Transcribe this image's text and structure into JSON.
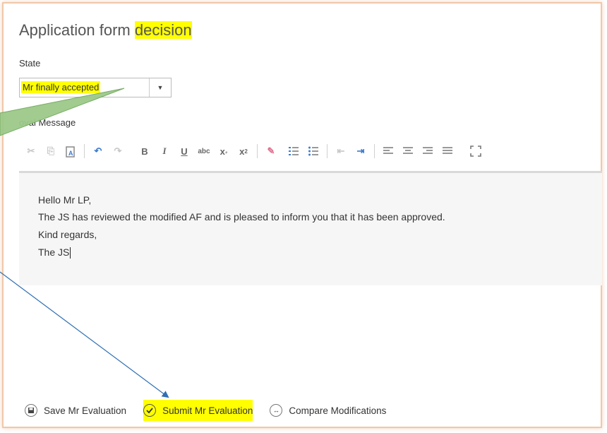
{
  "title": {
    "prefix": "Application form ",
    "highlight": "decision"
  },
  "state": {
    "label": "State",
    "selected": "Mr finally accepted"
  },
  "message": {
    "label": "oval Message"
  },
  "toolbar": {
    "items": [
      {
        "name": "cut-icon",
        "glyph": "✂"
      },
      {
        "name": "copy-icon",
        "glyph": "⎘"
      },
      {
        "name": "paste-text-icon",
        "glyph": "A"
      },
      {
        "name": "undo-icon",
        "glyph": "↶"
      },
      {
        "name": "redo-icon",
        "glyph": "↷"
      },
      {
        "name": "bold-icon",
        "glyph": "B"
      },
      {
        "name": "italic-icon",
        "glyph": "I"
      },
      {
        "name": "underline-icon",
        "glyph": "U"
      },
      {
        "name": "strikethrough-icon",
        "glyph": "abc"
      },
      {
        "name": "subscript-icon",
        "glyph": "x₂"
      },
      {
        "name": "superscript-icon",
        "glyph": "x²"
      },
      {
        "name": "remove-format-icon",
        "glyph": "✎"
      },
      {
        "name": "numbered-list-icon",
        "glyph": "≡"
      },
      {
        "name": "bulleted-list-icon",
        "glyph": "☰"
      },
      {
        "name": "outdent-icon",
        "glyph": "⇤"
      },
      {
        "name": "indent-icon",
        "glyph": "⇥"
      },
      {
        "name": "align-left-icon",
        "glyph": "≡"
      },
      {
        "name": "align-center-icon",
        "glyph": "≡"
      },
      {
        "name": "align-right-icon",
        "glyph": "≡"
      },
      {
        "name": "justify-icon",
        "glyph": "≡"
      },
      {
        "name": "maximize-icon",
        "glyph": "⛶"
      }
    ]
  },
  "editor": {
    "lines": [
      "Hello Mr LP,",
      "The JS has reviewed the modified AF and is pleased to inform you that it has been approved.",
      "Kind regards,",
      "The JS"
    ]
  },
  "actions": {
    "save": "Save Mr Evaluation",
    "submit": "Submit Mr Evaluation",
    "compare": "Compare Modifications"
  },
  "colors": {
    "highlight": "#ffff00",
    "arrow_blue": "#2f6fb5",
    "callout_green": "#9cc98a"
  }
}
